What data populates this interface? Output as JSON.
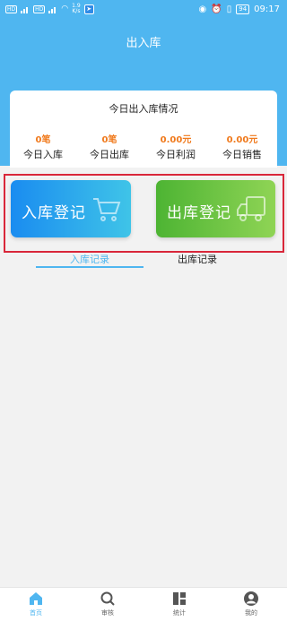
{
  "status_bar": {
    "net1": "HD",
    "net2": "HD",
    "sig1": "4G",
    "sig2": "4G",
    "speed": "1.9",
    "speed_unit": "K/s",
    "battery": "94",
    "time": "09:17"
  },
  "header": {
    "title": "出入库"
  },
  "stats": {
    "title": "今日出入库情况",
    "items": [
      {
        "value": "0笔",
        "label": "今日入库"
      },
      {
        "value": "0笔",
        "label": "今日出库"
      },
      {
        "value": "0.00元",
        "label": "今日利润"
      },
      {
        "value": "0.00元",
        "label": "今日销售"
      }
    ]
  },
  "actions": {
    "stock_in_label": "入库登记",
    "stock_out_label": "出库登记"
  },
  "tabs": [
    {
      "label": "入库记录",
      "active": true
    },
    {
      "label": "出库记录",
      "active": false
    }
  ],
  "bottom_nav": [
    {
      "label": "首页",
      "icon": "home-icon",
      "active": true
    },
    {
      "label": "审核",
      "icon": "search-icon",
      "active": false
    },
    {
      "label": "统计",
      "icon": "grid-icon",
      "active": false
    },
    {
      "label": "我的",
      "icon": "user-icon",
      "active": false
    }
  ],
  "colors": {
    "primary": "#4fb6f0",
    "accent_orange": "#f07a1d",
    "stock_in": "#1a8cf0",
    "stock_out": "#4db433",
    "highlight": "#d9273a"
  }
}
